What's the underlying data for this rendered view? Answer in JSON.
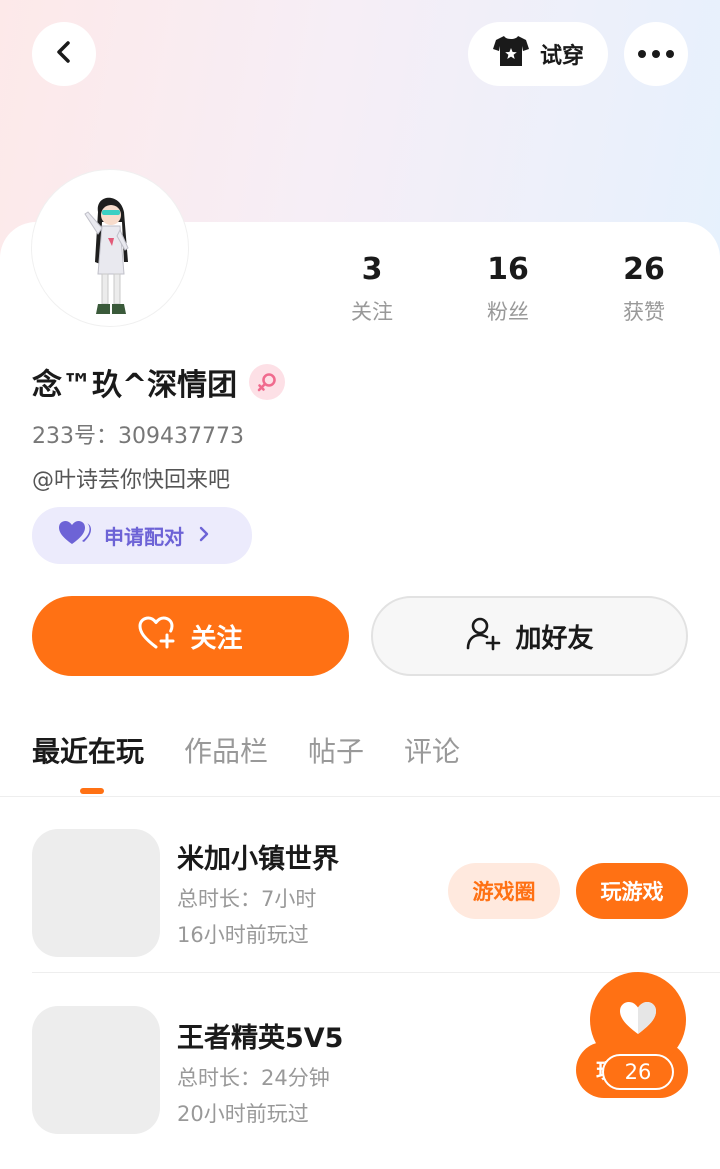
{
  "header": {
    "tryon_label": "试穿"
  },
  "profile": {
    "nickname": "念™玖^深情团",
    "user_id": "233号：309437773",
    "bio": "@叶诗芸你快回来吧",
    "pair_label": "申请配对"
  },
  "stats": [
    {
      "value": "3",
      "label": "关注"
    },
    {
      "value": "16",
      "label": "粉丝"
    },
    {
      "value": "26",
      "label": "获赞"
    }
  ],
  "actions": {
    "follow_label": "关注",
    "add_friend_label": "加好友"
  },
  "tabs": [
    "最近在玩",
    "作品栏",
    "帖子",
    "评论"
  ],
  "games": [
    {
      "name": "米加小镇世界",
      "duration": "总时长：7小时",
      "last_played": "16小时前玩过",
      "circle_label": "游戏圈",
      "play_label": "玩游戏"
    },
    {
      "name": "王者精英5V5",
      "duration": "总时长：24分钟",
      "last_played": "20小时前玩过",
      "play_label": "玩"
    }
  ],
  "like": {
    "count": "26"
  },
  "colors": {
    "accent": "#ff7114",
    "pair_bg": "#ecebfc",
    "pair_text": "#6d63d6",
    "gender_female": "#f06b8e"
  }
}
